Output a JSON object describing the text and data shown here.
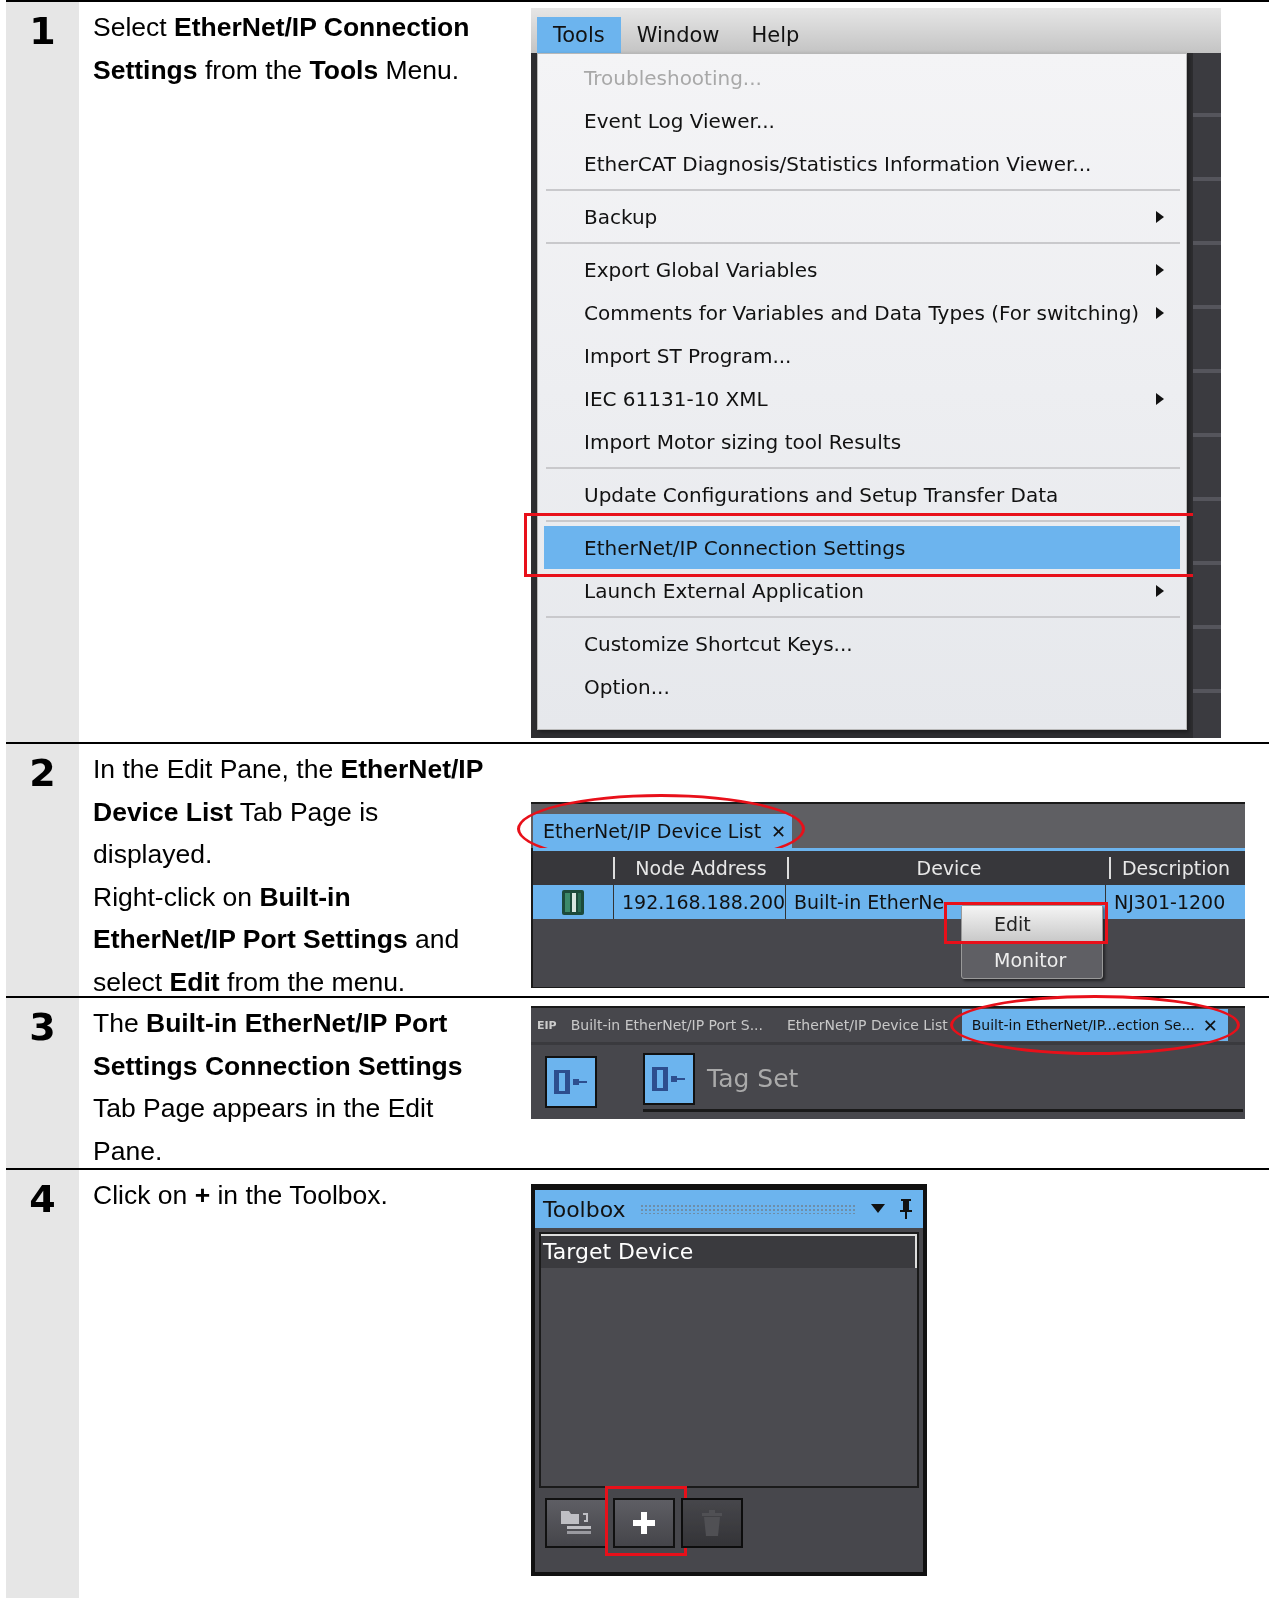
{
  "steps": [
    {
      "number": "1",
      "paragraphs": [
        "Select **EtherNet/IP Connection Settings** from the **Tools** Menu."
      ],
      "screenshot": {
        "kind": "menu",
        "menubar": [
          {
            "label": "Tools",
            "selected": true
          },
          {
            "label": "Window",
            "selected": false
          },
          {
            "label": "Help",
            "selected": false
          }
        ],
        "items": [
          {
            "kind": "item",
            "label": "Troubleshooting...",
            "disabled": true,
            "submenu": false,
            "selected": false
          },
          {
            "kind": "item",
            "label": "Event Log Viewer...",
            "disabled": false,
            "submenu": false,
            "selected": false
          },
          {
            "kind": "item",
            "label": "EtherCAT Diagnosis/Statistics Information Viewer...",
            "disabled": false,
            "submenu": false,
            "selected": false
          },
          {
            "kind": "separator"
          },
          {
            "kind": "item",
            "label": "Backup",
            "disabled": false,
            "submenu": true,
            "selected": false
          },
          {
            "kind": "separator"
          },
          {
            "kind": "item",
            "label": "Export Global Variables",
            "disabled": false,
            "submenu": true,
            "selected": false
          },
          {
            "kind": "item",
            "label": "Comments for Variables and Data Types (For switching)",
            "disabled": false,
            "submenu": true,
            "selected": false
          },
          {
            "kind": "item",
            "label": "Import ST Program...",
            "disabled": false,
            "submenu": false,
            "selected": false
          },
          {
            "kind": "item",
            "label": "IEC 61131-10 XML",
            "disabled": false,
            "submenu": true,
            "selected": false
          },
          {
            "kind": "item",
            "label": "Import Motor sizing tool Results",
            "disabled": false,
            "submenu": false,
            "selected": false
          },
          {
            "kind": "separator"
          },
          {
            "kind": "item",
            "label": "Update Configurations and Setup Transfer Data",
            "disabled": false,
            "submenu": false,
            "selected": false
          },
          {
            "kind": "separator"
          },
          {
            "kind": "item",
            "label": "EtherNet/IP Connection Settings",
            "disabled": false,
            "submenu": false,
            "selected": true,
            "circled": true
          },
          {
            "kind": "item",
            "label": "Launch External Application",
            "disabled": false,
            "submenu": true,
            "selected": false
          },
          {
            "kind": "separator"
          },
          {
            "kind": "item",
            "label": "Customize Shortcut Keys...",
            "disabled": false,
            "submenu": false,
            "selected": false
          },
          {
            "kind": "item",
            "label": "Option...",
            "disabled": false,
            "submenu": false,
            "selected": false
          }
        ]
      }
    },
    {
      "number": "2",
      "paragraphs": [
        "In the Edit Pane, the **EtherNet/IP Device List** Tab Page is displayed.",
        "Right-click on **Built-in EtherNet/IP Port Settings** and select **Edit** from the menu."
      ],
      "screenshot": {
        "kind": "device_list",
        "tab": {
          "label": "EtherNet/IP Device List",
          "close": "✕",
          "circled": true
        },
        "columns": [
          "Node Address",
          "Device",
          "Description"
        ],
        "row": {
          "node_address": "192.168.188.200",
          "device": "Built-in EtherNe",
          "description": "NJ301-1200",
          "selected": true
        },
        "context_menu": [
          {
            "label": "Edit",
            "selected": true,
            "circled": true
          },
          {
            "label": "Monitor",
            "selected": false
          }
        ]
      }
    },
    {
      "number": "3",
      "paragraphs": [
        "The **Built-in EtherNet/IP Port Settings Connection Settings** Tab Page appears in the Edit Pane."
      ],
      "screenshot": {
        "kind": "tabs",
        "tabs": [
          {
            "label": "Built-in EtherNet/IP Port S...",
            "selected": false
          },
          {
            "label": "EtherNet/IP Device List",
            "selected": false
          },
          {
            "label": "Built-in EtherNet/IP...ection Se...",
            "selected": true,
            "circled": true,
            "close": "✕"
          }
        ],
        "tab_icon": "EIP",
        "heading": "Tag Set"
      }
    },
    {
      "number": "4",
      "paragraphs": [
        "Click on **+** in the Toolbox."
      ],
      "screenshot": {
        "kind": "toolbox",
        "title": "Toolbox",
        "group": "Target Device",
        "buttons": [
          {
            "kind": "import",
            "disabled": false
          },
          {
            "kind": "add",
            "disabled": false,
            "circled": true
          },
          {
            "kind": "delete",
            "disabled": true
          }
        ]
      }
    }
  ]
}
